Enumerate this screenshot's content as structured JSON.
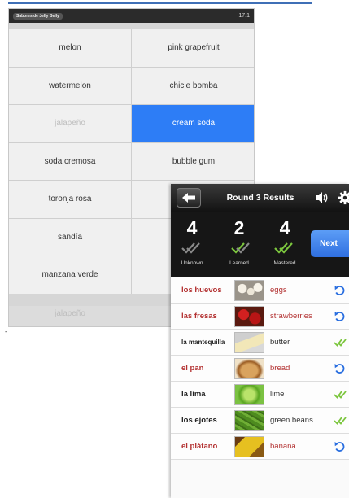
{
  "back_screen": {
    "status_title": "Sabores de Jelly Belly",
    "status_right": "17.1",
    "cells": [
      {
        "label": "melon",
        "state": "normal"
      },
      {
        "label": "pink grapefruit",
        "state": "normal"
      },
      {
        "label": "watermelon",
        "state": "normal"
      },
      {
        "label": "chicle bomba",
        "state": "normal"
      },
      {
        "label": "jalapeño",
        "state": "faded"
      },
      {
        "label": "cream soda",
        "state": "selected"
      },
      {
        "label": "soda cremosa",
        "state": "normal"
      },
      {
        "label": "bubble gum",
        "state": "normal"
      },
      {
        "label": "toronja rosa",
        "state": "normal"
      },
      {
        "label": "",
        "state": "normal"
      },
      {
        "label": "sandía",
        "state": "normal"
      },
      {
        "label": "",
        "state": "normal"
      },
      {
        "label": "manzana verde",
        "state": "normal"
      },
      {
        "label": "",
        "state": "normal"
      }
    ],
    "bottom_word": "jalapeño"
  },
  "results": {
    "title": "Round 3 Results",
    "stats": [
      {
        "count": "4",
        "label": "Unknown"
      },
      {
        "count": "2",
        "label": "Learned"
      },
      {
        "count": "4",
        "label": "Mastered"
      }
    ],
    "next_label": "Next",
    "rows": [
      {
        "spanish": "los huevos",
        "english": "eggs",
        "status": "retry",
        "image": "eggs"
      },
      {
        "spanish": "las fresas",
        "english": "strawberries",
        "status": "retry",
        "image": "strawberries"
      },
      {
        "spanish": "la mantequilla",
        "english": "butter",
        "status": "mastered",
        "image": "butter"
      },
      {
        "spanish": "el pan",
        "english": "bread",
        "status": "retry",
        "image": "bread"
      },
      {
        "spanish": "la lima",
        "english": "lime",
        "status": "mastered",
        "image": "lime"
      },
      {
        "spanish": "los ejotes",
        "english": "green beans",
        "status": "mastered",
        "image": "green-beans"
      },
      {
        "spanish": "el plátano",
        "english": "banana",
        "status": "retry",
        "image": "banana"
      }
    ]
  },
  "colors": {
    "selected_cell": "#2d7df6",
    "wrong_text": "#b33131",
    "retry_icon": "#2a6fe0",
    "check_green": "#7cc63e"
  }
}
